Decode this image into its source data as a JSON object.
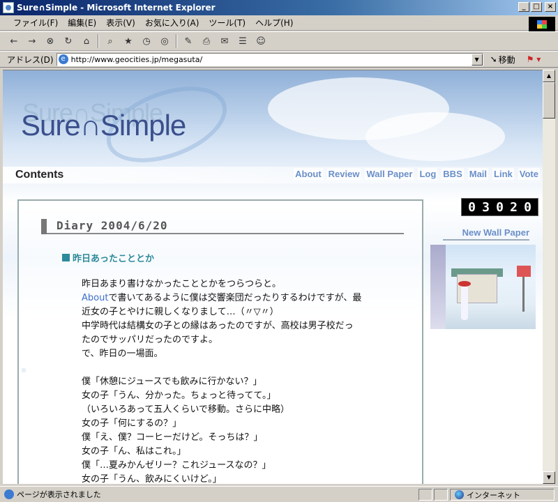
{
  "window": {
    "title": "Sure∩Simple - Microsoft Internet Explorer",
    "min": "_",
    "max": "□",
    "close": "×"
  },
  "menu": [
    "ファイル(F)",
    "編集(E)",
    "表示(V)",
    "お気に入り(A)",
    "ツール(T)",
    "ヘルプ(H)"
  ],
  "toolbar": {
    "back": "←",
    "forward": "→",
    "stop": "⊗",
    "refresh": "↻",
    "home": "⌂",
    "search": "⌕",
    "favorites": "★",
    "history": "◷",
    "media": "◎",
    "edit": "✎",
    "print": "⎙",
    "mail": "✉",
    "discuss": "☰",
    "messenger": "☺"
  },
  "address": {
    "label": "アドレス(D)",
    "url": "http://www.geocities.jp/megasuta/",
    "go": "移動"
  },
  "site": {
    "logo": "Sure∩Simple",
    "contents_label": "Contents",
    "nav": [
      "About",
      "Review",
      "Wall Paper",
      "Log",
      "BBS",
      "Mail",
      "Link",
      "Vote"
    ],
    "counter": [
      "0",
      "3",
      "0",
      "2",
      "0"
    ],
    "new_wallpaper": "New Wall Paper"
  },
  "diary": {
    "heading": "Diary  2004/6/20",
    "subheading": "昨日あったこととか",
    "line1": "昨日あまり書けなかったこととかをつらつらと。",
    "line2_link": "About",
    "line2_rest": "で書いてあるように僕は交響楽団だったりするわけですが、最",
    "line3": "近女の子とやけに親しくなりまして…（〃▽〃）",
    "line4": "中学時代は結構女の子との縁はあったのですが、高校は男子校だっ",
    "line5": "たのでサッパリだったのですよ。",
    "line6": "で、昨日の一場面。",
    "dialog": [
      "僕「休憩にジュースでも飲みに行かない？」",
      "女の子「うん、分かった。ちょっと待ってて。」",
      "（いろいろあって五人くらいで移動。さらに中略）",
      "女の子「何にするの？」",
      "僕「え、僕？コーヒーだけど。そっちは？」",
      "女の子「ん、私はこれ。」",
      "僕「…夏みかんゼリー？これジュースなの？」",
      "女の子「うん、飲みにくいけど。」"
    ]
  },
  "status": {
    "text": "ページが表示されました",
    "zone": "インターネット"
  }
}
